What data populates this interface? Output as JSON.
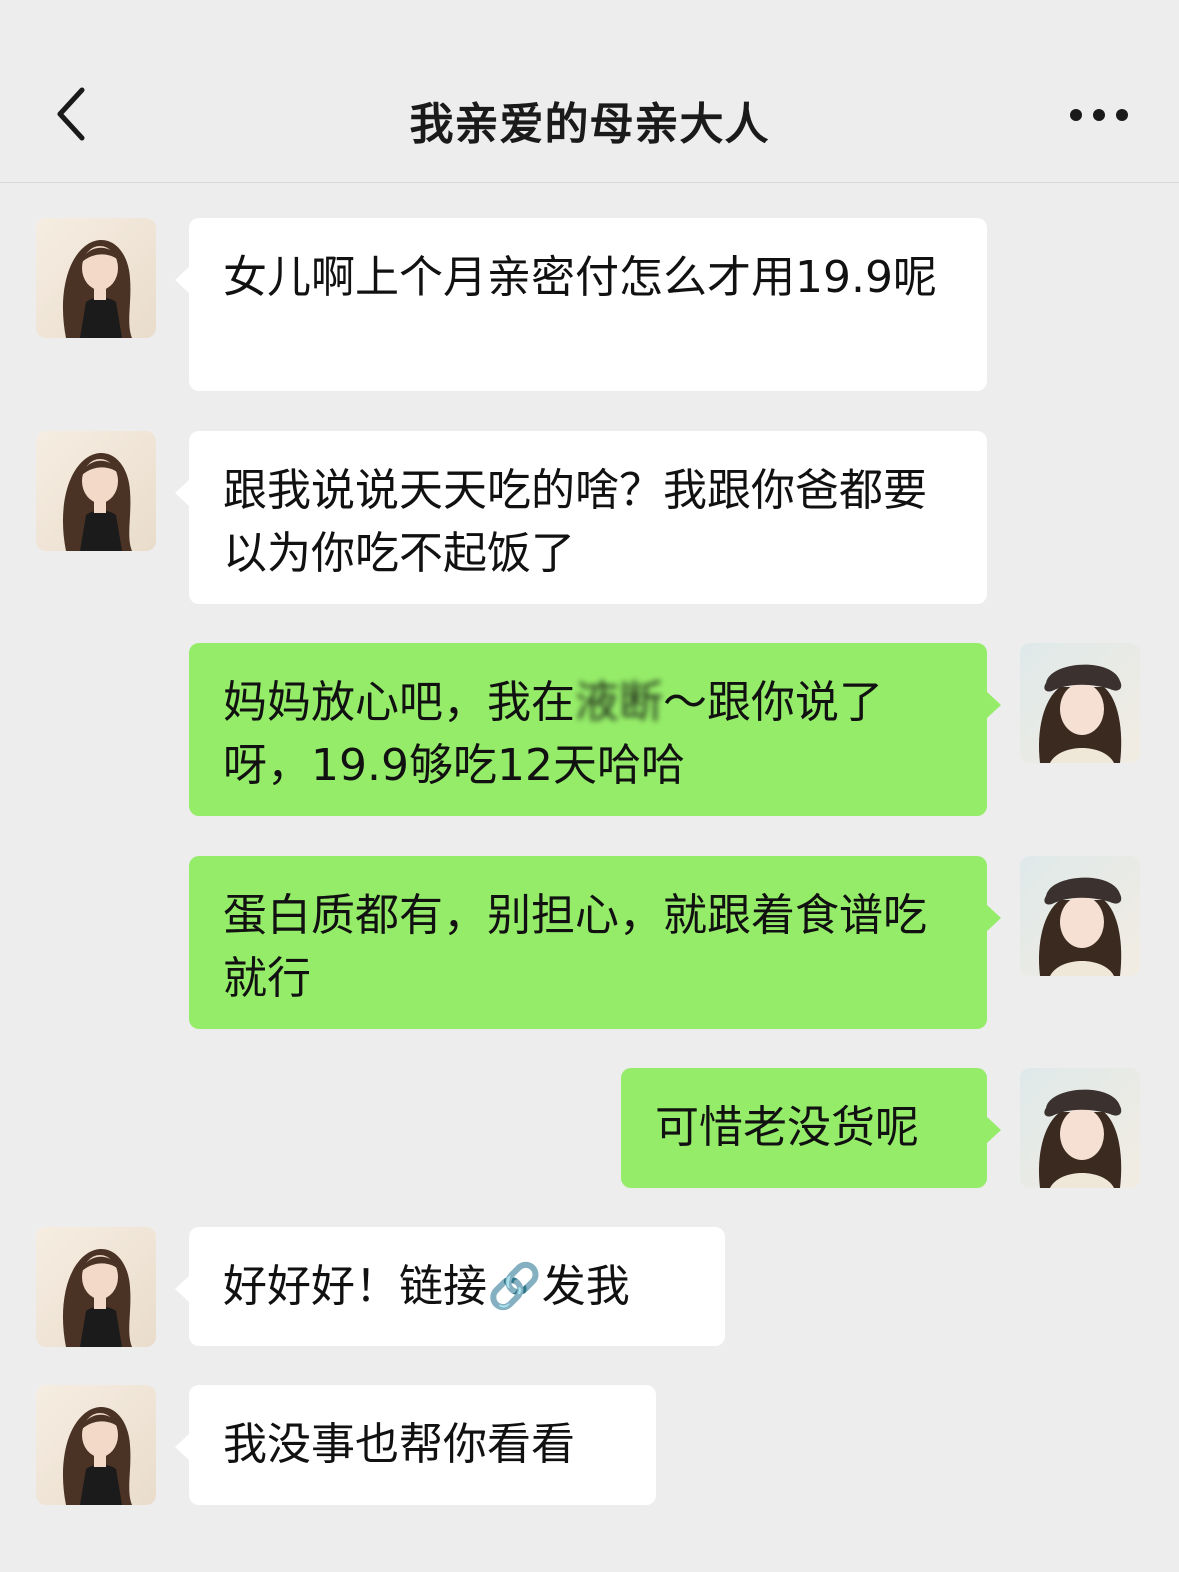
{
  "header": {
    "title": "我亲爱的母亲大人"
  },
  "messages": [
    {
      "side": "in",
      "text": "女儿啊上个月亲密付怎么才用19.9呢"
    },
    {
      "side": "in",
      "text": "跟我说说天天吃的啥？我跟你爸都要以为你吃不起饭了"
    },
    {
      "side": "out",
      "text_before": "妈妈放心吧，我在",
      "text_blurred": "液断",
      "text_after": "～跟你说了呀，19.9够吃12天哈哈"
    },
    {
      "side": "out",
      "text": "蛋白质都有，别担心，就跟着食谱吃就行"
    },
    {
      "side": "out",
      "text": "可惜老没货呢"
    },
    {
      "side": "in",
      "text_before": "好好好！链接",
      "emoji": "🔗",
      "text_after": "发我"
    },
    {
      "side": "in",
      "text": "我没事也帮你看看"
    }
  ],
  "colors": {
    "background": "#ededed",
    "incoming_bubble": "#ffffff",
    "outgoing_bubble": "#95ec69"
  },
  "icons": {
    "back": "chevron-left-icon",
    "more": "more-dots-icon"
  }
}
